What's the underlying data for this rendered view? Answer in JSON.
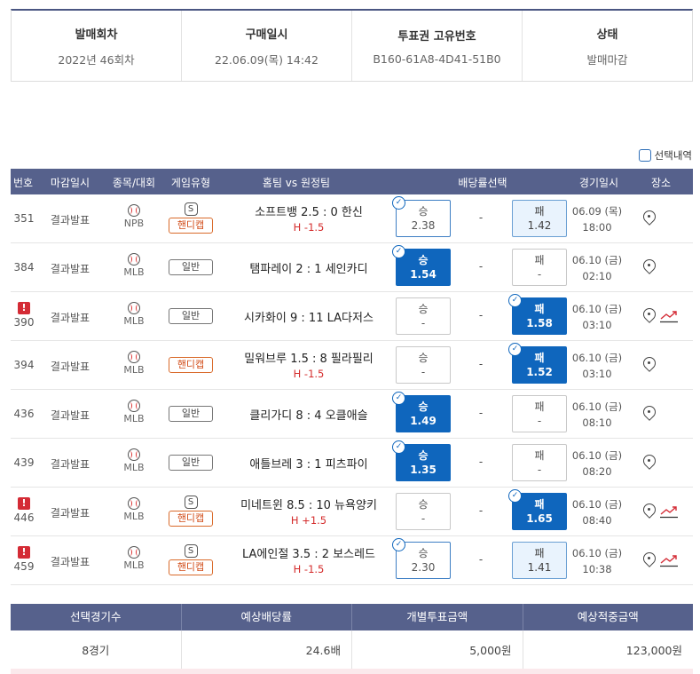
{
  "info": [
    {
      "label": "발매회차",
      "value": "2022년 46회차"
    },
    {
      "label": "구매일시",
      "value": "22.06.09(목) 14:42"
    },
    {
      "label": "투표권 고유번호",
      "value": "B160-61A8-4D41-51B0"
    },
    {
      "label": "상태",
      "value": "발매마감"
    }
  ],
  "legend": {
    "label": "선택내역"
  },
  "table": {
    "headers": {
      "num": "번호",
      "deadline": "마감일시",
      "sport": "종목/대회",
      "gtype": "게임유형",
      "match": "홈팀 vs 원정팀",
      "odds": "배당률선택",
      "date": "경기일시",
      "place": "장소"
    },
    "rows": [
      {
        "num": "351",
        "alert": false,
        "deadline": "결과발표",
        "league": "NPB",
        "s_icon": "S",
        "type": "핸디캡",
        "type_style": "handi",
        "match": "소프트뱅 2.5 : 0 한신",
        "handicap": "H -1.5",
        "win": {
          "label": "승",
          "value": "2.38"
        },
        "draw": "-",
        "lose": {
          "label": "패",
          "value": "1.42"
        },
        "win_state": "selbox",
        "lose_state": "final",
        "win_check": true,
        "lose_check": false,
        "date": "06.09 (목)",
        "time": "18:00",
        "trend": false
      },
      {
        "num": "384",
        "alert": false,
        "deadline": "결과발표",
        "league": "MLB",
        "s_icon": "",
        "type": "일반",
        "type_style": "normal",
        "match": "탬파레이 2 : 1 세인카디",
        "handicap": "",
        "win": {
          "label": "승",
          "value": "1.54"
        },
        "draw": "-",
        "lose": {
          "label": "패",
          "value": "-"
        },
        "win_state": "sel",
        "lose_state": "plain",
        "win_check": true,
        "lose_check": false,
        "date": "06.10 (금)",
        "time": "02:10",
        "trend": false
      },
      {
        "num": "390",
        "alert": true,
        "deadline": "결과발표",
        "league": "MLB",
        "s_icon": "",
        "type": "일반",
        "type_style": "normal",
        "match": "시카화이 9 : 11 LA다저스",
        "handicap": "",
        "win": {
          "label": "승",
          "value": "-"
        },
        "draw": "-",
        "lose": {
          "label": "패",
          "value": "1.58"
        },
        "win_state": "plain",
        "lose_state": "sel",
        "win_check": false,
        "lose_check": true,
        "date": "06.10 (금)",
        "time": "03:10",
        "trend": true
      },
      {
        "num": "394",
        "alert": false,
        "deadline": "결과발표",
        "league": "MLB",
        "s_icon": "",
        "type": "핸디캡",
        "type_style": "handi",
        "match": "밀워브루 1.5 : 8 필라필리",
        "handicap": "H -1.5",
        "win": {
          "label": "승",
          "value": "-"
        },
        "draw": "-",
        "lose": {
          "label": "패",
          "value": "1.52"
        },
        "win_state": "plain",
        "lose_state": "sel",
        "win_check": false,
        "lose_check": true,
        "date": "06.10 (금)",
        "time": "03:10",
        "trend": false
      },
      {
        "num": "436",
        "alert": false,
        "deadline": "결과발표",
        "league": "MLB",
        "s_icon": "",
        "type": "일반",
        "type_style": "normal",
        "match": "클리가디 8 : 4 오클애슬",
        "handicap": "",
        "win": {
          "label": "승",
          "value": "1.49"
        },
        "draw": "-",
        "lose": {
          "label": "패",
          "value": "-"
        },
        "win_state": "sel",
        "lose_state": "plain",
        "win_check": true,
        "lose_check": false,
        "date": "06.10 (금)",
        "time": "08:10",
        "trend": false
      },
      {
        "num": "439",
        "alert": false,
        "deadline": "결과발표",
        "league": "MLB",
        "s_icon": "",
        "type": "일반",
        "type_style": "normal",
        "match": "애틀브레 3 : 1 피츠파이",
        "handicap": "",
        "win": {
          "label": "승",
          "value": "1.35"
        },
        "draw": "-",
        "lose": {
          "label": "패",
          "value": "-"
        },
        "win_state": "sel",
        "lose_state": "plain",
        "win_check": true,
        "lose_check": false,
        "date": "06.10 (금)",
        "time": "08:20",
        "trend": false
      },
      {
        "num": "446",
        "alert": true,
        "deadline": "결과발표",
        "league": "MLB",
        "s_icon": "S",
        "type": "핸디캡",
        "type_style": "handi",
        "match": "미네트윈 8.5 : 10 뉴욕양키",
        "handicap": "H +1.5",
        "win": {
          "label": "승",
          "value": "-"
        },
        "draw": "-",
        "lose": {
          "label": "패",
          "value": "1.65"
        },
        "win_state": "plain",
        "lose_state": "sel",
        "win_check": false,
        "lose_check": true,
        "date": "06.10 (금)",
        "time": "08:40",
        "trend": true
      },
      {
        "num": "459",
        "alert": true,
        "deadline": "결과발표",
        "league": "MLB",
        "s_icon": "S",
        "type": "핸디캡",
        "type_style": "handi",
        "match": "LA에인절 3.5 : 2 보스레드",
        "handicap": "H -1.5",
        "win": {
          "label": "승",
          "value": "2.30"
        },
        "draw": "-",
        "lose": {
          "label": "패",
          "value": "1.41"
        },
        "win_state": "selbox",
        "lose_state": "final",
        "win_check": true,
        "lose_check": false,
        "date": "06.10 (금)",
        "time": "10:38",
        "trend": true
      }
    ]
  },
  "summary": {
    "headers": [
      "선택경기수",
      "예상배당률",
      "개별투표금액",
      "예상적중금액"
    ],
    "values": [
      "8경기",
      "24.6배",
      "5,000원",
      "123,000원"
    ]
  },
  "colors": {
    "header_bg": "#56618c",
    "selected": "#0f66bd",
    "alert": "#d42b35",
    "handicap": "#d14b17"
  }
}
